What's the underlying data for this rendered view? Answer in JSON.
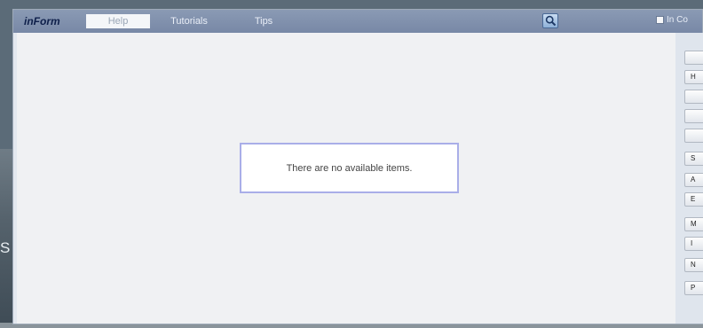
{
  "background": {
    "left_text": "S"
  },
  "topbar": {
    "brand": "inForm",
    "tabs": [
      {
        "label": "Help",
        "active": true
      },
      {
        "label": "Tutorials",
        "active": false
      },
      {
        "label": "Tips",
        "active": false
      }
    ],
    "search_icon": "search-icon",
    "in_col_label": "In Co"
  },
  "content": {
    "empty_message": "There are no available items."
  },
  "sidepanel": {
    "buttons": [
      {
        "label": ""
      },
      {
        "label": "H"
      },
      {
        "label": ""
      },
      {
        "label": ""
      },
      {
        "label": ""
      },
      {
        "label": "S"
      },
      {
        "label": "A"
      },
      {
        "label": "E"
      },
      {
        "label": "M"
      },
      {
        "label": "I"
      },
      {
        "label": "N"
      },
      {
        "label": "P"
      }
    ]
  },
  "colors": {
    "topbar": "#7f90ad",
    "content": "#f0f1f3",
    "empty_box_border": "#a9aee8"
  }
}
